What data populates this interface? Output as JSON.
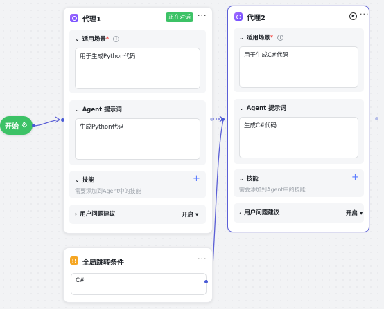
{
  "start": {
    "label": "开始",
    "icon": "gear-icon"
  },
  "agents": [
    {
      "title": "代理1",
      "badge": "正在对话",
      "more": "···",
      "scenario": {
        "title": "适用场景",
        "required": "*",
        "value": "用于生成Python代码"
      },
      "prompt": {
        "title": "Agent 提示词",
        "value": "生成Python代码"
      },
      "skills": {
        "title": "技能",
        "hint": "需要添加到Agent中的技能",
        "add": "+"
      },
      "suggest": {
        "title": "用户问题建议",
        "toggle": "开启 ▾"
      }
    },
    {
      "title": "代理2",
      "play": "▶",
      "more": "···",
      "scenario": {
        "title": "适用场景",
        "required": "*",
        "value": "用于生成C#代码"
      },
      "prompt": {
        "title": "Agent 提示词",
        "value": "生成C#代码"
      },
      "skills": {
        "title": "技能",
        "hint": "需要添加到Agent中的技能",
        "add": "+"
      },
      "suggest": {
        "title": "用户问题建议",
        "toggle": "开启 ▾"
      }
    }
  ],
  "global_jump": {
    "title": "全局跳转条件",
    "more": "···",
    "value": "C#"
  },
  "icons": {
    "chevron_down": "⌄",
    "chevron_right": "›",
    "info": "i"
  },
  "colors": {
    "accent": "#5b5fd6",
    "start": "#3cc266",
    "badge": "#3cc266",
    "condition": "#f5a623"
  }
}
